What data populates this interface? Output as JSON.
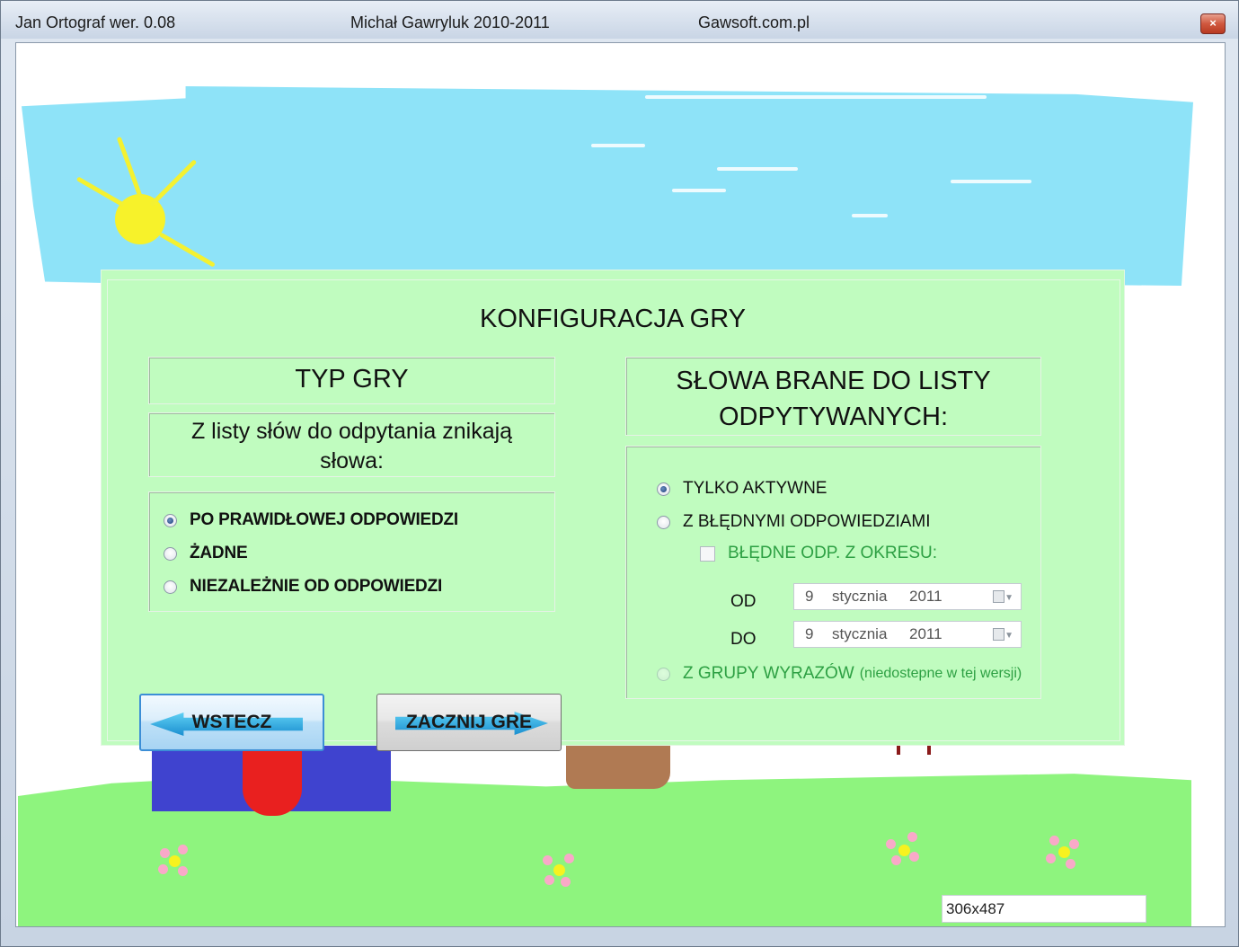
{
  "titlebar": {
    "app_title": "Jan Ortograf wer. 0.08",
    "author": "Michał Gawryluk 2010-2011",
    "website": "Gawsoft.com.pl",
    "close_label": "×"
  },
  "panel": {
    "title": "KONFIGURACJA GRY",
    "game_type": {
      "title": "TYP GRY",
      "subtitle": "Z listy słów do odpytania znikają słowa:",
      "options": [
        {
          "label": "PO PRAWIDŁOWEJ ODPOWIEDZI",
          "checked": true
        },
        {
          "label": "ŻADNE",
          "checked": false
        },
        {
          "label": "NIEZALEŻNIE OD ODPOWIEDZI",
          "checked": false
        }
      ]
    },
    "words": {
      "title_line1": "SŁOWA BRANE DO LISTY",
      "title_line2": "ODPYTYWANYCH:",
      "only_active": {
        "label": "TYLKO AKTYWNE",
        "checked": true
      },
      "with_wrong": {
        "label": "Z BŁĘDNYMI ODPOWIEDZIAMI",
        "checked": false
      },
      "wrong_period": {
        "label": "BŁĘDNE ODP. Z OKRESU:",
        "checked": false
      },
      "from_label": "OD",
      "to_label": "DO",
      "from_date": {
        "day": "9",
        "month": "stycznia",
        "year": "2011"
      },
      "to_date": {
        "day": "9",
        "month": "stycznia",
        "year": "2011"
      },
      "word_group": {
        "label": "Z GRUPY WYRAZÓW",
        "note": "(niedostepne w tej wersji)",
        "checked": false
      }
    },
    "buttons": {
      "back_label": "WSTECZ",
      "start_label": "ZACZNIJ GRE"
    }
  },
  "status": {
    "size_text": "306x487"
  },
  "colors": {
    "panel_bg": "#c0fcbf",
    "sky": "#8ee3f8",
    "grass": "#8ef47e",
    "green_text": "#2da043"
  }
}
